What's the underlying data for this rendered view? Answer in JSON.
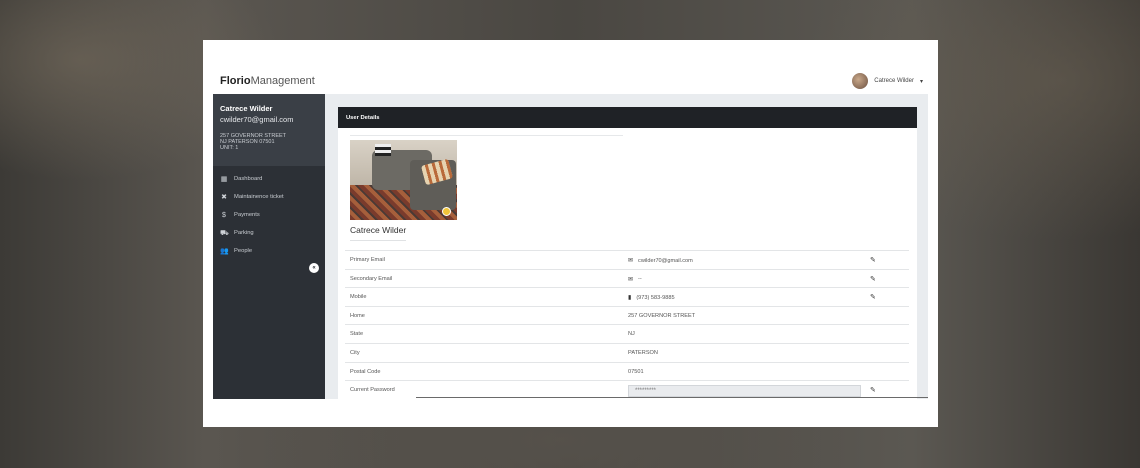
{
  "brand": {
    "bold": "Florio",
    "light": "Management"
  },
  "user_menu": {
    "name": "Catrece Wilder",
    "caret": "▾"
  },
  "sidebar": {
    "name": "Catrece Wilder",
    "email": "cwilder70@gmail.com",
    "address_line1": "257 GOVERNOR STREET",
    "address_line2": "NJ PATERSON 07501",
    "address_line3": "UNIT: 1",
    "items": [
      {
        "label": "Dashboard",
        "icon": "grid-icon",
        "glyph": "▦"
      },
      {
        "label": "Maintainence ticket",
        "icon": "tools-icon",
        "glyph": "✖"
      },
      {
        "label": "Payments",
        "icon": "dollar-icon",
        "glyph": "$"
      },
      {
        "label": "Parking",
        "icon": "car-icon",
        "glyph": "⛟"
      },
      {
        "label": "People",
        "icon": "people-icon",
        "glyph": "👥"
      }
    ],
    "collapse_glyph": "«"
  },
  "card": {
    "title": "User Details"
  },
  "profile": {
    "name": "Catrece Wilder"
  },
  "details": [
    {
      "label": "Primary Email",
      "value": "cwilder70@gmail.com",
      "icon": "envelope-icon",
      "glyph": "✉",
      "editable": true
    },
    {
      "label": "Secondary Email",
      "value": "--",
      "icon": "envelope-icon",
      "glyph": "✉",
      "editable": true
    },
    {
      "label": "Mobile",
      "value": "(973) 583-9885",
      "icon": "phone-icon",
      "glyph": "▮",
      "editable": true
    },
    {
      "label": "Home",
      "value": "257 GOVERNOR STREET",
      "editable": false
    },
    {
      "label": "State",
      "value": "NJ",
      "editable": false
    },
    {
      "label": "City",
      "value": "PATERSON",
      "editable": false
    },
    {
      "label": "Postal Code",
      "value": "07501",
      "editable": false
    }
  ],
  "password": {
    "label": "Current Password",
    "value": "*********"
  },
  "pencil_glyph": "✎"
}
